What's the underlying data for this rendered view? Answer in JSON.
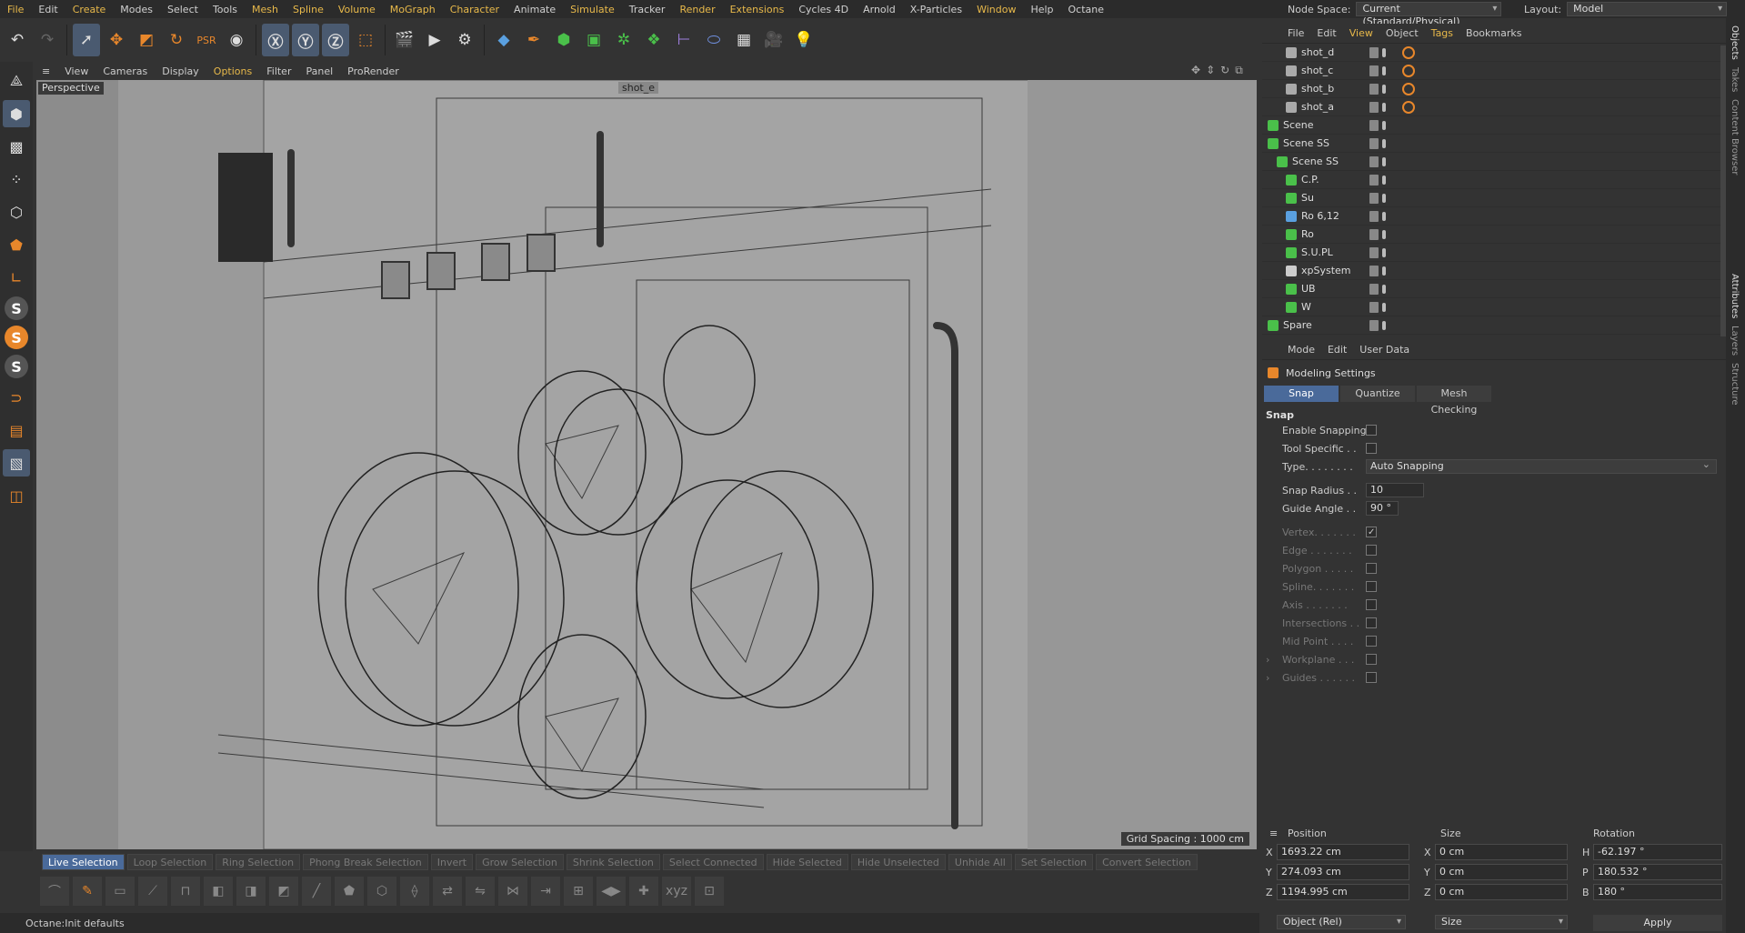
{
  "menu": [
    "File",
    "Edit",
    "Create",
    "Modes",
    "Select",
    "Tools",
    "Mesh",
    "Spline",
    "Volume",
    "MoGraph",
    "Character",
    "Animate",
    "Simulate",
    "Tracker",
    "Render",
    "Extensions",
    "Cycles 4D",
    "Arnold",
    "X-Particles",
    "Window",
    "Help",
    "Octane"
  ],
  "node_space": {
    "label": "Node Space:",
    "value": "Current (Standard/Physical)"
  },
  "layout": {
    "label": "Layout:",
    "value": "Model"
  },
  "viewport": {
    "menu": [
      "View",
      "Cameras",
      "Display",
      "Options",
      "Filter",
      "Panel",
      "ProRender"
    ],
    "label": "Perspective",
    "camera_tag": "shot_e",
    "grid_spacing": "Grid Spacing : 1000 cm"
  },
  "selection_tools": [
    "Live Selection",
    "Loop Selection",
    "Ring Selection",
    "Phong Break Selection",
    "Invert",
    "Grow Selection",
    "Shrink Selection",
    "Select Connected",
    "Hide Selected",
    "Hide Unselected",
    "Unhide All",
    "Set Selection",
    "Convert Selection"
  ],
  "status": "Octane:Init defaults",
  "objects": {
    "menu": [
      "File",
      "Edit",
      "View",
      "Object",
      "Tags",
      "Bookmarks"
    ],
    "rows": [
      {
        "name": "shot_d",
        "indent": 2,
        "icon": "camera-icon",
        "tag": true
      },
      {
        "name": "shot_c",
        "indent": 2,
        "icon": "camera-icon",
        "tag": true
      },
      {
        "name": "shot_b",
        "indent": 2,
        "icon": "camera-icon",
        "tag": true
      },
      {
        "name": "shot_a",
        "indent": 2,
        "icon": "camera-icon",
        "tag": true
      },
      {
        "name": "Scene",
        "indent": 0,
        "icon": "null-icon"
      },
      {
        "name": "Scene SS",
        "indent": 0,
        "icon": "null-icon"
      },
      {
        "name": "Scene SS",
        "indent": 1,
        "icon": "null-icon"
      },
      {
        "name": "C.P.",
        "indent": 2,
        "icon": "null-icon"
      },
      {
        "name": "Su",
        "indent": 2,
        "icon": "null-icon"
      },
      {
        "name": "Ro 6,12",
        "indent": 2,
        "icon": "mesh-icon"
      },
      {
        "name": "Ro",
        "indent": 2,
        "icon": "null-icon"
      },
      {
        "name": "S.U.PL",
        "indent": 2,
        "icon": "null-icon"
      },
      {
        "name": "xpSystem",
        "indent": 2,
        "icon": "xp-icon"
      },
      {
        "name": "UB",
        "indent": 2,
        "icon": "null-icon"
      },
      {
        "name": "W",
        "indent": 2,
        "icon": "null-icon"
      },
      {
        "name": "Spare",
        "indent": 0,
        "icon": "null-icon"
      }
    ]
  },
  "attributes": {
    "menu": [
      "Mode",
      "Edit",
      "User Data"
    ],
    "title": "Modeling Settings",
    "tabs": [
      "Snap",
      "Quantize",
      "Mesh Checking"
    ],
    "section": "Snap",
    "enable_snapping": "Enable Snapping",
    "tool_specific": "Tool Specific . .",
    "type_label": "Type. . . . . . . .",
    "type_value": "Auto Snapping",
    "snap_radius_label": "Snap Radius . .",
    "snap_radius": "10",
    "guide_angle_label": "Guide Angle . .",
    "guide_angle": "90 °",
    "vertex": "Vertex. . . . . . .",
    "edge": "Edge . . . . . . .",
    "polygon": "Polygon . . . . .",
    "spline": "Spline. . . . . . .",
    "axis": "Axis . . . . . . .",
    "intersections": "Intersections . .",
    "midpoint": "Mid Point . . . .",
    "workplane": "Workplane . . .",
    "guides": "Guides . . . . . ."
  },
  "coords": {
    "position": "Position",
    "size": "Size",
    "rotation": "Rotation",
    "px": "1693.22 cm",
    "py": "274.093 cm",
    "pz": "1194.995 cm",
    "sx": "0 cm",
    "sy": "0 cm",
    "sz": "0 cm",
    "rh": "-62.197 °",
    "rp": "180.532 °",
    "rb": "180 °",
    "mode": "Object (Rel)",
    "size_mode": "Size",
    "apply": "Apply"
  },
  "right_tabs": [
    "Objects",
    "Takes",
    "Content Browser",
    "Attributes",
    "Layers",
    "Structure"
  ]
}
